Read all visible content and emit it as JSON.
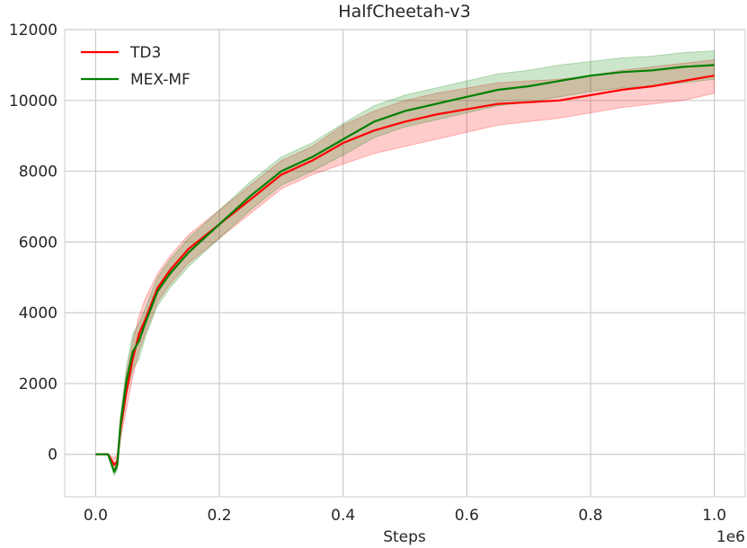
{
  "chart_data": {
    "type": "line",
    "title": "HalfCheetah-v3",
    "xlabel": "Steps",
    "ylabel": "",
    "x_offset_text": "1e6",
    "xlim": [
      -0.05,
      1.05
    ],
    "ylim": [
      -1200,
      12000
    ],
    "xticks": [
      0.0,
      0.2,
      0.4,
      0.6,
      0.8,
      1.0
    ],
    "xtick_labels": [
      "0.0",
      "0.2",
      "0.4",
      "0.6",
      "0.8",
      "1.0"
    ],
    "yticks": [
      0,
      2000,
      4000,
      6000,
      8000,
      10000,
      12000
    ],
    "ytick_labels": [
      "0",
      "2000",
      "4000",
      "6000",
      "8000",
      "10000",
      "12000"
    ],
    "grid": true,
    "legend_position": "top-left",
    "series": [
      {
        "name": "TD3",
        "color": "#ff0000",
        "x": [
          0.0,
          0.02,
          0.03,
          0.035,
          0.04,
          0.05,
          0.06,
          0.07,
          0.08,
          0.1,
          0.12,
          0.15,
          0.2,
          0.25,
          0.3,
          0.35,
          0.4,
          0.45,
          0.5,
          0.55,
          0.6,
          0.65,
          0.7,
          0.75,
          0.8,
          0.85,
          0.9,
          0.95,
          1.0
        ],
        "y": [
          0,
          0,
          -300,
          -200,
          700,
          1800,
          2700,
          3400,
          3800,
          4700,
          5200,
          5800,
          6500,
          7200,
          7900,
          8300,
          8800,
          9150,
          9400,
          9600,
          9750,
          9900,
          9950,
          10000,
          10150,
          10300,
          10400,
          10550,
          10700
        ],
        "band_low": [
          0,
          0,
          -500,
          -400,
          400,
          1300,
          2200,
          2900,
          3400,
          4300,
          4800,
          5400,
          6100,
          6800,
          7500,
          7900,
          8200,
          8500,
          8700,
          8900,
          9100,
          9300,
          9400,
          9500,
          9650,
          9800,
          9900,
          10000,
          10200
        ],
        "band_high": [
          0,
          0,
          -100,
          0,
          1000,
          2300,
          3200,
          3900,
          4400,
          5100,
          5600,
          6200,
          6900,
          7600,
          8300,
          8700,
          9300,
          9700,
          10000,
          10200,
          10350,
          10500,
          10550,
          10600,
          10700,
          10850,
          10950,
          11050,
          11150
        ]
      },
      {
        "name": "MEX-MF",
        "color": "#008000",
        "x": [
          0.0,
          0.02,
          0.03,
          0.035,
          0.04,
          0.05,
          0.06,
          0.07,
          0.08,
          0.1,
          0.12,
          0.15,
          0.2,
          0.25,
          0.3,
          0.35,
          0.4,
          0.45,
          0.5,
          0.55,
          0.6,
          0.65,
          0.7,
          0.75,
          0.8,
          0.85,
          0.9,
          0.95,
          1.0
        ],
        "y": [
          0,
          0,
          -500,
          -300,
          800,
          2100,
          2900,
          3200,
          3700,
          4600,
          5100,
          5700,
          6500,
          7300,
          8000,
          8400,
          8900,
          9400,
          9700,
          9900,
          10100,
          10300,
          10400,
          10550,
          10700,
          10800,
          10850,
          10950,
          11000
        ],
        "band_low": [
          0,
          0,
          -600,
          -450,
          500,
          1700,
          2400,
          2700,
          3300,
          4200,
          4700,
          5300,
          6100,
          6900,
          7600,
          8000,
          8450,
          8950,
          9250,
          9450,
          9650,
          9850,
          9950,
          10100,
          10250,
          10350,
          10400,
          10500,
          10600
        ],
        "band_high": [
          0,
          0,
          -400,
          -150,
          1100,
          2500,
          3400,
          3700,
          4100,
          5000,
          5500,
          6100,
          6900,
          7700,
          8400,
          8800,
          9350,
          9850,
          10150,
          10350,
          10550,
          10750,
          10850,
          11000,
          11100,
          11200,
          11250,
          11350,
          11400
        ]
      }
    ]
  }
}
